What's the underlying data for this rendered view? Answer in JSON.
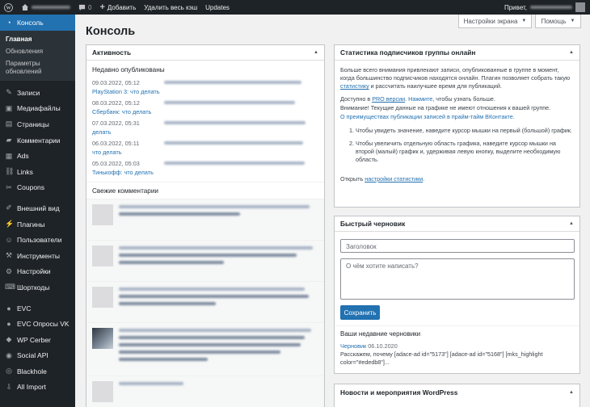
{
  "adminbar": {
    "comments_count": "0",
    "add_label": "Добавить",
    "clear_cache_label": "Удалить весь кэш",
    "updates_label": "Updates",
    "greeting": "Привет,"
  },
  "screen_options": {
    "screen_label": "Настройки экрана",
    "help_label": "Помощь"
  },
  "sidebar": {
    "console_label": "Консоль",
    "submenu": [
      "Главная",
      "Обновления",
      "Параметры обновлений"
    ],
    "items": [
      {
        "label": "Записи",
        "icon": "pin-icon"
      },
      {
        "label": "Медиафайлы",
        "icon": "media-icon"
      },
      {
        "label": "Страницы",
        "icon": "page-icon"
      },
      {
        "label": "Комментарии",
        "icon": "comment-icon"
      },
      {
        "label": "Ads",
        "icon": "ads-icon"
      },
      {
        "label": "Links",
        "icon": "links-icon"
      },
      {
        "label": "Coupons",
        "icon": "coupon-icon"
      },
      {
        "label": "Внешний вид",
        "icon": "brush-icon"
      },
      {
        "label": "Плагины",
        "icon": "plugin-icon"
      },
      {
        "label": "Пользователи",
        "icon": "users-icon"
      },
      {
        "label": "Инструменты",
        "icon": "wrench-icon"
      },
      {
        "label": "Настройки",
        "icon": "settings-icon"
      },
      {
        "label": "Шорткоды",
        "icon": "shortcode-icon"
      },
      {
        "label": "EVC",
        "icon": "evc-icon"
      },
      {
        "label": "EVC Опросы VK",
        "icon": "poll-icon"
      },
      {
        "label": "WP Cerber",
        "icon": "shield-icon"
      },
      {
        "label": "Social API",
        "icon": "social-icon"
      },
      {
        "label": "Blackhole",
        "icon": "blackhole-icon"
      },
      {
        "label": "All Import",
        "icon": "import-icon"
      }
    ]
  },
  "page": {
    "title": "Консоль"
  },
  "activity": {
    "title": "Активность",
    "recent_published_title": "Недавно опубликованы",
    "published": [
      {
        "date": "09.03.2022, 05:12",
        "link": "PlayStation 3: что делать"
      },
      {
        "date": "08.03.2022, 05:12",
        "link": "Сбербанк: что делать"
      },
      {
        "date": "07.03.2022, 05:31",
        "link": "делать"
      },
      {
        "date": "06.03.2022, 05:11",
        "link": "что делать"
      },
      {
        "date": "05.03.2022, 05:03",
        "link": "Тинькофф: что делать"
      }
    ],
    "recent_comments_title": "Свежие комментарии"
  },
  "stats": {
    "title": "Статистика подписчиков группы онлайн",
    "intro_1": "Больше всего внимания привлекают записи, опубликованные в группе в момент, когда большинство подписчиков находятся онлайн. Плагин позволяет собрать такую ",
    "intro_link": "статистику",
    "intro_2": " и рассчитать наилучшее время для публикаций.",
    "pro_prefix": "Доступно в ",
    "pro_link": "PRO версии",
    "pro_suffix_link": "Нажмите",
    "pro_suffix": ", чтобы узнать больше.",
    "note": "Внимание! Текущие данные на графике не имеют отношения к вашей группе.",
    "advantages_link": "О преимуществах публикации записей в прайм-тайм ВКонтакте.",
    "steps": [
      "Чтобы увидеть значение, наведите курсор мышки на первый (большой) график.",
      "Чтобы увеличить отдельную область графика, наведите курсор мышки на второй (малый) график и, удерживая левую кнопку, выделите необходимую область."
    ],
    "open_prefix": "Открыть ",
    "open_link": "настройки статистики",
    "open_suffix": "."
  },
  "quick_draft": {
    "title": "Быстрый черновик",
    "title_placeholder": "Заголовок",
    "content_placeholder": "О чём хотите написать?",
    "save_label": "Сохранить",
    "recent_drafts_title": "Ваши недавние черновики",
    "draft_link": "Черновик",
    "draft_date": "06.10.2020",
    "draft_excerpt": "Расскажем, почему [adace-ad id=\"5173\"] [adace-ad id=\"5168\"] [mks_highlight color=\"#ededb8\"]..."
  },
  "news": {
    "title": "Новости и мероприятия WordPress"
  },
  "colors": {
    "accent": "#2271b1",
    "adminbar": "#1d2327",
    "background": "#f1f1f1"
  }
}
